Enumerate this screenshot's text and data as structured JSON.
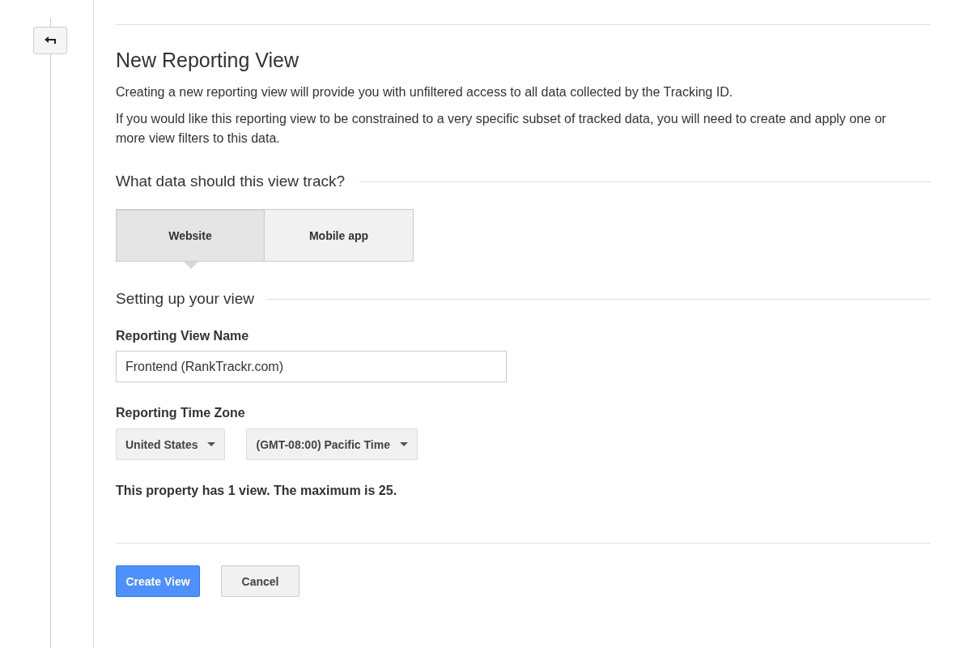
{
  "title": "New Reporting View",
  "intro": [
    "Creating a new reporting view will provide you with unfiltered access to all data collected by the Tracking ID.",
    "If you would like this reporting view to be constrained to a very specific subset of tracked data, you will need to create and apply one or more view filters to this data."
  ],
  "track_section": {
    "heading": "What data should this view track?",
    "options": [
      {
        "label": "Website",
        "selected": true
      },
      {
        "label": "Mobile app",
        "selected": false
      }
    ]
  },
  "setup_section": {
    "heading": "Setting up your view"
  },
  "view_name": {
    "label": "Reporting View Name",
    "value": "Frontend (RankTrackr.com)"
  },
  "time_zone": {
    "label": "Reporting Time Zone",
    "dropdowns": [
      "United States",
      "(GMT-08:00) Pacific Time"
    ]
  },
  "note": "This property has 1 view. The maximum is 25.",
  "buttons": [
    {
      "label": "Create View",
      "kind": "primary"
    },
    {
      "label": "Cancel",
      "kind": "secondary"
    }
  ]
}
